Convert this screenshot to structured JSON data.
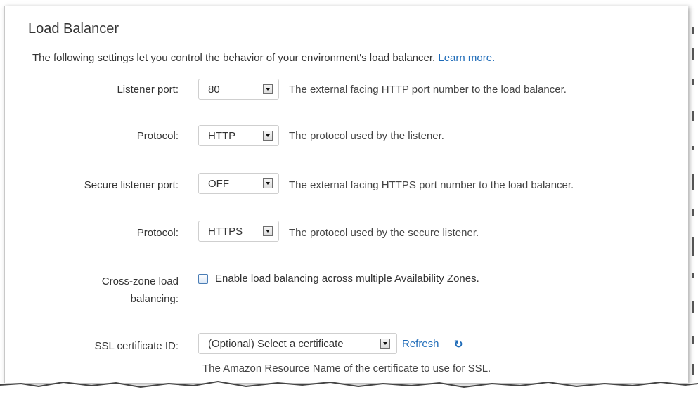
{
  "section": {
    "title": "Load Balancer",
    "intro_text": "The following settings let you control the behavior of your environment's load balancer.",
    "learn_more": "Learn more."
  },
  "fields": {
    "listener_port": {
      "label": "Listener port:",
      "value": "80",
      "help": "The external facing HTTP port number to the load balancer."
    },
    "protocol": {
      "label": "Protocol:",
      "value": "HTTP",
      "help": "The protocol used by the listener."
    },
    "secure_listener_port": {
      "label": "Secure listener port:",
      "value": "OFF",
      "help": "The external facing HTTPS port number to the load balancer."
    },
    "secure_protocol": {
      "label": "Protocol:",
      "value": "HTTPS",
      "help": "The protocol used by the secure listener."
    },
    "cross_zone": {
      "label_line1": "Cross-zone load",
      "label_line2": "balancing:",
      "checkbox_label": "Enable load balancing across multiple Availability Zones.",
      "checked": false
    },
    "ssl_certificate": {
      "label": "SSL certificate ID:",
      "value": "(Optional) Select a certificate",
      "refresh": "Refresh",
      "refresh_icon": "↻",
      "help": "The Amazon Resource Name of the certificate to use for SSL."
    }
  },
  "colors": {
    "link": "#1e6bb8",
    "text": "#333333",
    "checkbox_border": "#4a7db5"
  }
}
